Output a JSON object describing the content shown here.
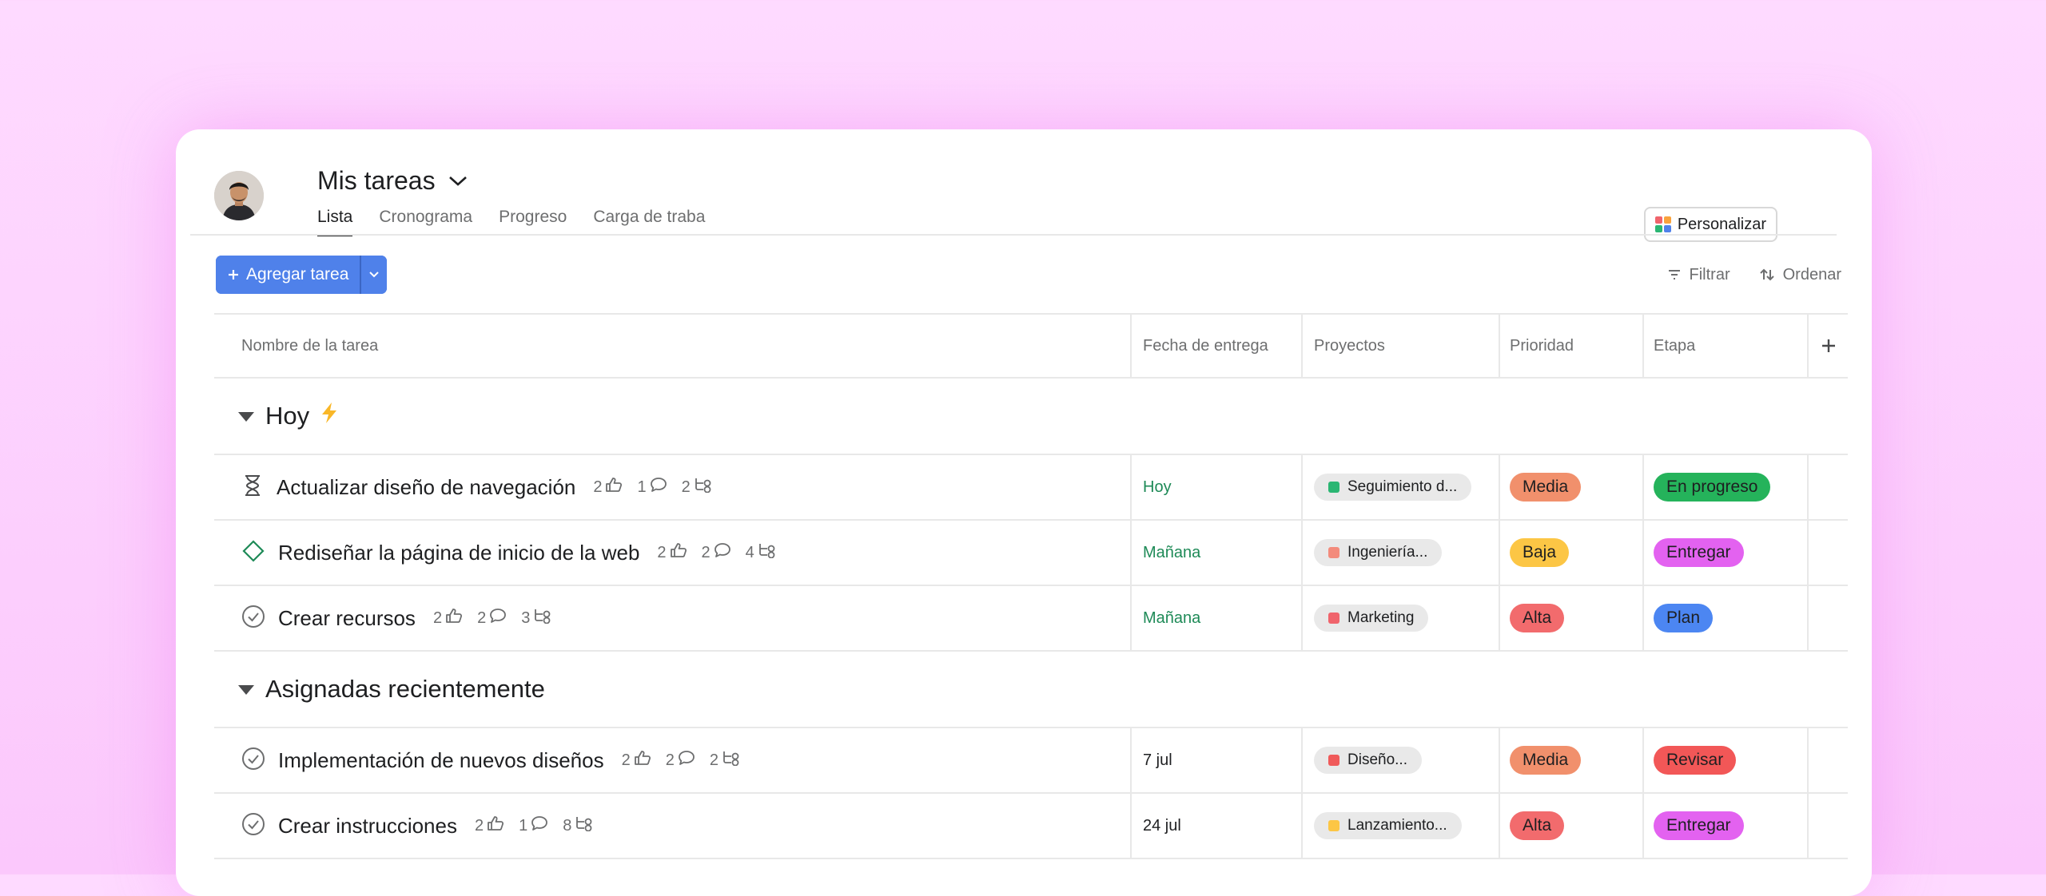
{
  "header": {
    "title": "Mis tareas",
    "tabs": [
      {
        "label": "Lista",
        "active": true
      },
      {
        "label": "Cronograma",
        "active": false
      },
      {
        "label": "Progreso",
        "active": false
      },
      {
        "label": "Carga de traba",
        "active": false
      }
    ],
    "customize_label": "Personalizar",
    "customize_icon": "grid-icon",
    "avatar_icon": "user-avatar"
  },
  "toolbar": {
    "add_label": "Agregar tarea",
    "filter_label": "Filtrar",
    "sort_label": "Ordenar"
  },
  "columns": {
    "name": "Nombre de la tarea",
    "due": "Fecha de entrega",
    "projects": "Proyectos",
    "priority": "Prioridad",
    "stage": "Etapa",
    "add_icon": "plus-icon"
  },
  "sections": [
    {
      "title": "Hoy",
      "icon": "lightning-icon",
      "tasks": [
        {
          "status_icon": "hourglass-icon",
          "name": "Actualizar diseño de navegación",
          "likes": "2",
          "comments": "1",
          "subtasks": "2",
          "due": "Hoy",
          "due_style": "green",
          "project": "Seguimiento d...",
          "project_color": "#2bb673",
          "priority": "Media",
          "priority_color": "#f1906c",
          "stage": "En progreso",
          "stage_color": "#25b35b"
        },
        {
          "status_icon": "diamond-icon",
          "name": "Rediseñar la página de inicio de la web",
          "likes": "2",
          "comments": "2",
          "subtasks": "4",
          "due": "Mañana",
          "due_style": "green",
          "project": "Ingeniería...",
          "project_color": "#f38b7c",
          "priority": "Baja",
          "priority_color": "#fcc645",
          "stage": "Entregar",
          "stage_color": "#e362f0"
        },
        {
          "status_icon": "check-circle-icon",
          "name": "Crear recursos",
          "likes": "2",
          "comments": "2",
          "subtasks": "3",
          "due": "Mañana",
          "due_style": "green",
          "project": "Marketing",
          "project_color": "#f0646c",
          "priority": "Alta",
          "priority_color": "#f26b6d",
          "stage": "Plan",
          "stage_color": "#4c86f2"
        }
      ]
    },
    {
      "title": "Asignadas recientemente",
      "icon": "",
      "tasks": [
        {
          "status_icon": "check-circle-icon",
          "name": "Implementación de nuevos diseños",
          "likes": "2",
          "comments": "2",
          "subtasks": "2",
          "due": "7 jul",
          "due_style": "dark",
          "project": "Diseño...",
          "project_color": "#f05a5a",
          "priority": "Media",
          "priority_color": "#f1906c",
          "stage": "Revisar",
          "stage_color": "#f25757"
        },
        {
          "status_icon": "check-circle-icon",
          "name": "Crear instrucciones",
          "likes": "2",
          "comments": "1",
          "subtasks": "8",
          "due": "24 jul",
          "due_style": "dark",
          "project": "Lanzamiento...",
          "project_color": "#fcc645",
          "priority": "Alta",
          "priority_color": "#f26b6d",
          "stage": "Entregar",
          "stage_color": "#e362f0"
        }
      ]
    }
  ]
}
